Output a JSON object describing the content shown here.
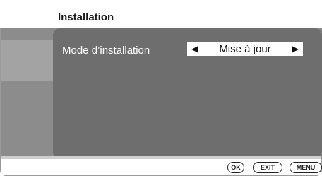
{
  "header": {
    "title": "Installation"
  },
  "settings": {
    "rows": [
      {
        "label": "Mode d’installation",
        "value": "Mise à jour"
      }
    ]
  },
  "footer": {
    "keys": [
      {
        "label": "OK"
      },
      {
        "label": "EXIT"
      },
      {
        "label": "MENU"
      }
    ]
  },
  "icons": {
    "prev": "left-arrow-icon",
    "next": "right-arrow-icon"
  },
  "colors": {
    "panel": "#6e6e6e",
    "backdrop": "#8c8c8c",
    "highlight": "#ffffff"
  }
}
